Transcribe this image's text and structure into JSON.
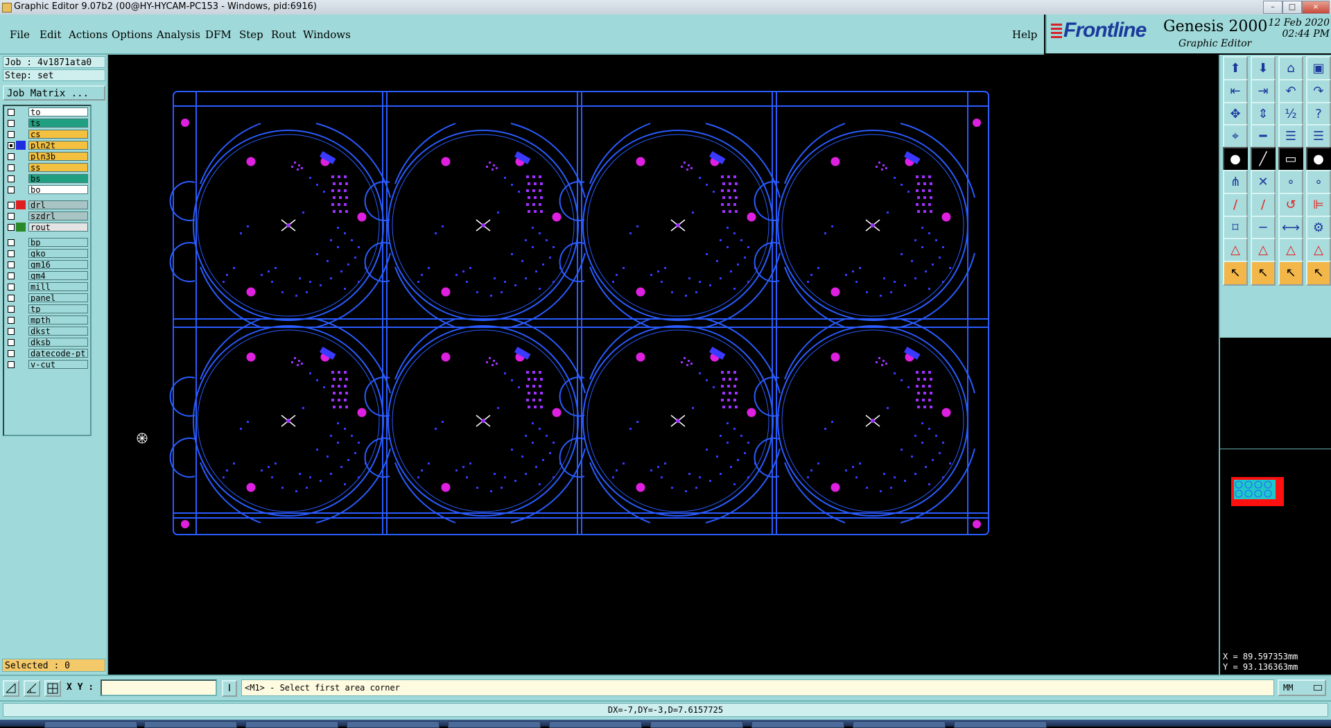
{
  "window": {
    "title": "Graphic Editor 9.07b2 (00@HY-HYCAM-PC153 - Windows, pid:6916)",
    "controls": [
      "–",
      "□",
      "×"
    ]
  },
  "menu": {
    "items": [
      "File",
      "Edit",
      "Actions",
      "Options",
      "Analysis",
      "DFM",
      "Step",
      "Rout",
      "Windows"
    ],
    "help": "Help"
  },
  "brand": {
    "logo": "Frontline",
    "product": "Genesis 2000",
    "subtitle": "Graphic Editor",
    "date": "12 Feb 2020",
    "time": "02:44 PM"
  },
  "job": {
    "job_line": "Job : 4v1871ata0",
    "step_line": "Step: set",
    "matrix_button": "Job Matrix ..."
  },
  "layers": [
    {
      "name": "to",
      "color": "#ffffff",
      "swatch": "",
      "checked": false
    },
    {
      "name": "ts",
      "color": "#20a080",
      "swatch": "",
      "checked": false
    },
    {
      "name": "cs",
      "color": "#f3c040",
      "swatch": "",
      "checked": false
    },
    {
      "name": "pln2t",
      "color": "#f3c040",
      "swatch": "#1e2ee0",
      "checked": true
    },
    {
      "name": "pln3b",
      "color": "#f3c040",
      "swatch": "",
      "checked": false
    },
    {
      "name": "ss",
      "color": "#f3c040",
      "swatch": "",
      "checked": false
    },
    {
      "name": "bs",
      "color": "#20a080",
      "swatch": "",
      "checked": false
    },
    {
      "name": "bo",
      "color": "#ffffff",
      "swatch": "",
      "checked": false
    },
    {
      "name": "drl",
      "color": "#a9c4c4",
      "swatch": "#e02020",
      "checked": false
    },
    {
      "name": "szdrl",
      "color": "#a9c4c4",
      "swatch": "",
      "checked": false
    },
    {
      "name": "rout",
      "color": "#e4e4e4",
      "swatch": "#2a8a2a",
      "checked": false
    },
    {
      "name": "bp",
      "color": "#9fd9d9",
      "swatch": "",
      "checked": false
    },
    {
      "name": "gko",
      "color": "#9fd9d9",
      "swatch": "",
      "checked": false
    },
    {
      "name": "gm16",
      "color": "#9fd9d9",
      "swatch": "",
      "checked": false
    },
    {
      "name": "gm4",
      "color": "#9fd9d9",
      "swatch": "",
      "checked": false
    },
    {
      "name": "mill",
      "color": "#9fd9d9",
      "swatch": "",
      "checked": false
    },
    {
      "name": "panel",
      "color": "#9fd9d9",
      "swatch": "",
      "checked": false
    },
    {
      "name": "tp",
      "color": "#9fd9d9",
      "swatch": "",
      "checked": false
    },
    {
      "name": "mpth",
      "color": "#9fd9d9",
      "swatch": "",
      "checked": false
    },
    {
      "name": "dkst",
      "color": "#9fd9d9",
      "swatch": "",
      "checked": false
    },
    {
      "name": "dksb",
      "color": "#9fd9d9",
      "swatch": "",
      "checked": false
    },
    {
      "name": "datecode-pt",
      "color": "#9fd9d9",
      "swatch": "",
      "checked": false
    },
    {
      "name": "v-cut",
      "color": "#9fd9d9",
      "swatch": "",
      "checked": false
    }
  ],
  "selected": "Selected : 0",
  "board": {
    "outline_color": "#2a5cff",
    "pad_color": "#e020e0",
    "via_color": "#3a3aff",
    "smd_color": "#a030ff",
    "rows": 2,
    "cols": 4
  },
  "toolbar": {
    "icons": [
      "open-job-icon",
      "save-job-icon",
      "home-icon",
      "window-layout-icon",
      "step-prev-icon",
      "step-next-icon",
      "undo-icon",
      "redo-icon",
      "zoom-fit-icon",
      "pan-icon",
      "scale-1to2-icon",
      "help-query-icon",
      "drill-tool-icon",
      "line-tool-icon",
      "layer-stack-icon",
      "layer-stack-2-icon",
      "add-pad-icon",
      "add-line-icon",
      "ruler-icon",
      "circle-icon",
      "connect-nodes-icon",
      "delete-node-icon",
      "node-edit-icon",
      "node-edit-2-icon",
      "draw-line-icon",
      "draw-line-2-icon",
      "arc-icon",
      "align-icon",
      "snap-icon",
      "split-icon",
      "measure-icon",
      "components-icon",
      "triangle-icon",
      "triangle-2-icon",
      "triangle-3-icon",
      "triangle-4-icon",
      "pointer-icon",
      "pointer-2-icon",
      "pointer-3-icon",
      "pointer-4-icon"
    ]
  },
  "coordinates": {
    "x": "X = 89.597353mm",
    "y": "Y = 93.136363mm"
  },
  "command": {
    "xy_label": "X Y :",
    "xy_value": "",
    "i_button": "I",
    "prompt": "<M1> - Select first area corner",
    "units": "MM"
  },
  "status": "DX=-7,DY=-3,D=7.6157725"
}
